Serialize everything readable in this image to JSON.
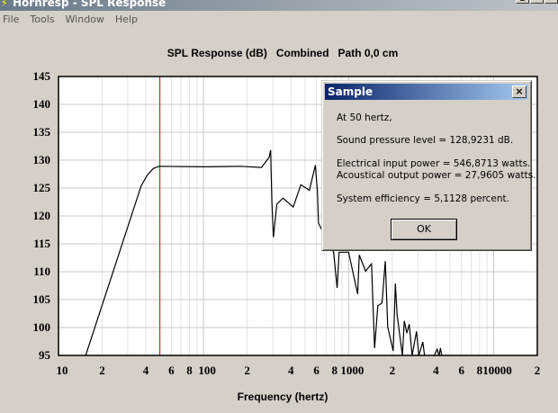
{
  "window": {
    "title": "Hornresp - SPL Response",
    "controls": [
      "_",
      "□",
      "×"
    ]
  },
  "menu": [
    "File",
    "Tools",
    "Window",
    "Help"
  ],
  "dialog": {
    "title": "Sample",
    "lines": [
      "At 50 hertz,",
      "Sound pressure level = 128,9231 dB.",
      "Electrical input power = 546,8713 watts.",
      "Acoustical output power = 27,9605 watts.",
      "System efficiency = 5,1128 percent."
    ],
    "ok_label": "OK",
    "close_label": "×"
  },
  "colors": {
    "curve": "#000000",
    "cursor": "#e00000",
    "grid": "#c8c8c8",
    "grid_minor": "#e4e4e4"
  },
  "chart_data": {
    "type": "line",
    "title": "SPL Response (dB)   Combined   Path 0,0 cm",
    "xlabel": "Frequency (hertz)",
    "ylabel": "",
    "xscale": "log",
    "xlim": [
      10,
      20000
    ],
    "ylim": [
      95,
      145
    ],
    "yticks": [
      "145",
      "140",
      "135",
      "130",
      "125",
      "120",
      "115",
      "110",
      "105",
      "100",
      "95"
    ],
    "xticks": [
      {
        "f": 10,
        "label": "10"
      },
      {
        "f": 20,
        "label": "2"
      },
      {
        "f": 40,
        "label": "4"
      },
      {
        "f": 60,
        "label": "6"
      },
      {
        "f": 80,
        "label": "8"
      },
      {
        "f": 100,
        "label": "100"
      },
      {
        "f": 200,
        "label": "2"
      },
      {
        "f": 400,
        "label": "4"
      },
      {
        "f": 600,
        "label": "6"
      },
      {
        "f": 800,
        "label": "8"
      },
      {
        "f": 1000,
        "label": "1000"
      },
      {
        "f": 2000,
        "label": "2"
      },
      {
        "f": 4000,
        "label": "4"
      },
      {
        "f": 6000,
        "label": "6"
      },
      {
        "f": 8000,
        "label": "8"
      },
      {
        "f": 10000,
        "label": "10000"
      },
      {
        "f": 20000,
        "label": "2"
      }
    ],
    "cursor_frequency": 50,
    "grid": true,
    "series": [
      {
        "name": "SPL",
        "points": [
          [
            14.5,
            93
          ],
          [
            15.4,
            95
          ],
          [
            37.2,
            125.4
          ],
          [
            40.9,
            127.3
          ],
          [
            45,
            128.5
          ],
          [
            49.5,
            128.9
          ],
          [
            100,
            128.8
          ],
          [
            180,
            128.9
          ],
          [
            251,
            128.7
          ],
          [
            283,
            130.5
          ],
          [
            290,
            131.8
          ],
          [
            296,
            122.4
          ],
          [
            303,
            116.2
          ],
          [
            320,
            122.1
          ],
          [
            353,
            123.2
          ],
          [
            415,
            121.6
          ],
          [
            469,
            125.6
          ],
          [
            537,
            124.6
          ],
          [
            590,
            129.1
          ],
          [
            610,
            124.3
          ],
          [
            620,
            118.7
          ],
          [
            700,
            116
          ],
          [
            789,
            113.5
          ],
          [
            834,
            107.1
          ],
          [
            860,
            113.5
          ],
          [
            1000,
            113.5
          ],
          [
            1155,
            106
          ],
          [
            1185,
            113
          ],
          [
            1310,
            110.1
          ],
          [
            1440,
            111.4
          ],
          [
            1510,
            96.3
          ],
          [
            1590,
            103.9
          ],
          [
            1700,
            104.4
          ],
          [
            1790,
            111.9
          ],
          [
            1860,
            100.1
          ],
          [
            2030,
            95.8
          ],
          [
            2100,
            107.9
          ],
          [
            2160,
            102.3
          ],
          [
            2350,
            95
          ],
          [
            2420,
            101.2
          ],
          [
            2520,
            99
          ],
          [
            2620,
            100.6
          ],
          [
            2740,
            95
          ],
          [
            2940,
            99.3
          ],
          [
            3050,
            95
          ],
          [
            3250,
            97.4
          ],
          [
            3340,
            95
          ],
          [
            3600,
            93
          ],
          [
            4080,
            96.1
          ],
          [
            4200,
            95
          ],
          [
            4300,
            96.3
          ],
          [
            4500,
            93
          ]
        ]
      }
    ]
  }
}
